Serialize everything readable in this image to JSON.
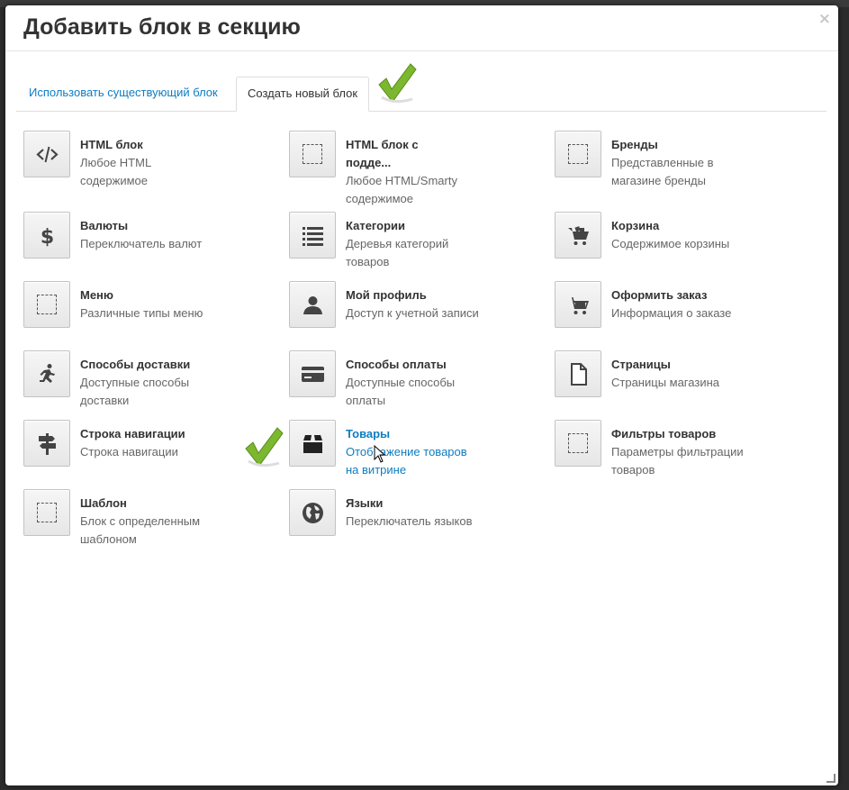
{
  "modal": {
    "title": "Добавить блок в секцию",
    "close_glyph": "×"
  },
  "tabs": [
    {
      "label": "Использовать существующий блок",
      "active": false
    },
    {
      "label": "Создать новый блок",
      "active": true
    }
  ],
  "colors": {
    "accent": "#0e7dc2",
    "check": "#7cb82f"
  },
  "items": [
    {
      "title": "HTML блок",
      "desc": "Любое HTML содержимое",
      "desc_lines": [
        "Любое HTML",
        "содержимое"
      ],
      "icon": "code-icon"
    },
    {
      "title": "HTML блок с подде...",
      "title_lines": [
        "HTML блок с",
        "подде..."
      ],
      "desc": "Любое HTML/Smarty содержимое",
      "desc_lines": [
        "Любое HTML/Smarty",
        "содержимое"
      ],
      "icon": "dashed-square-icon"
    },
    {
      "title": "Бренды",
      "desc": "Представленные в магазине бренды",
      "desc_lines": [
        "Представленные в",
        "магазине бренды"
      ],
      "icon": "dashed-square-icon"
    },
    {
      "title": "Валюты",
      "desc": "Переключатель валют",
      "desc_lines": [
        "Переключатель валют"
      ],
      "icon": "dollar-icon"
    },
    {
      "title": "Категории",
      "desc": "Деревья категорий товаров",
      "desc_lines": [
        "Деревья категорий",
        "товаров"
      ],
      "icon": "list-icon"
    },
    {
      "title": "Корзина",
      "desc": "Содержимое корзины",
      "desc_lines": [
        "Содержимое корзины"
      ],
      "icon": "cart-full-icon"
    },
    {
      "title": "Меню",
      "desc": "Различные типы меню",
      "desc_lines": [
        "Различные типы меню"
      ],
      "icon": "dashed-square-icon"
    },
    {
      "title": "Мой профиль",
      "desc": "Доступ к учетной записи",
      "desc_lines": [
        "Доступ к учетной записи"
      ],
      "icon": "user-icon"
    },
    {
      "title": "Оформить заказ",
      "desc": "Информация о заказе",
      "desc_lines": [
        "Информация о заказе"
      ],
      "icon": "cart-icon"
    },
    {
      "title": "Способы доставки",
      "desc": "Доступные способы доставки",
      "desc_lines": [
        "Доступные способы",
        "доставки"
      ],
      "icon": "running-man-icon"
    },
    {
      "title": "Способы оплаты",
      "desc": "Доступные способы оплаты",
      "desc_lines": [
        "Доступные способы",
        "оплаты"
      ],
      "icon": "credit-card-icon"
    },
    {
      "title": "Страницы",
      "desc": "Страницы магазина",
      "desc_lines": [
        "Страницы магазина"
      ],
      "icon": "page-icon"
    },
    {
      "title": "Строка навигации",
      "desc": "Строка навигации",
      "desc_lines": [
        "Строка навигации"
      ],
      "icon": "signpost-icon"
    },
    {
      "title": "Товары",
      "desc": "Отображение товаров на витрине",
      "desc_lines": [
        "Отображение товаров",
        "на витрине"
      ],
      "icon": "box-icon",
      "active": true
    },
    {
      "title": "Фильтры товаров",
      "desc": "Параметры фильтрации товаров",
      "desc_lines": [
        "Параметры фильтрации",
        "товаров"
      ],
      "icon": "dashed-square-icon"
    },
    {
      "title": "Шаблон",
      "desc": "Блок с определенным шаблоном",
      "desc_lines": [
        "Блок с определенным",
        "шаблоном"
      ],
      "icon": "dashed-square-icon"
    },
    {
      "title": "Языки",
      "desc": "Переключатель языков",
      "desc_lines": [
        "Переключатель языков"
      ],
      "icon": "globe-icon"
    }
  ]
}
